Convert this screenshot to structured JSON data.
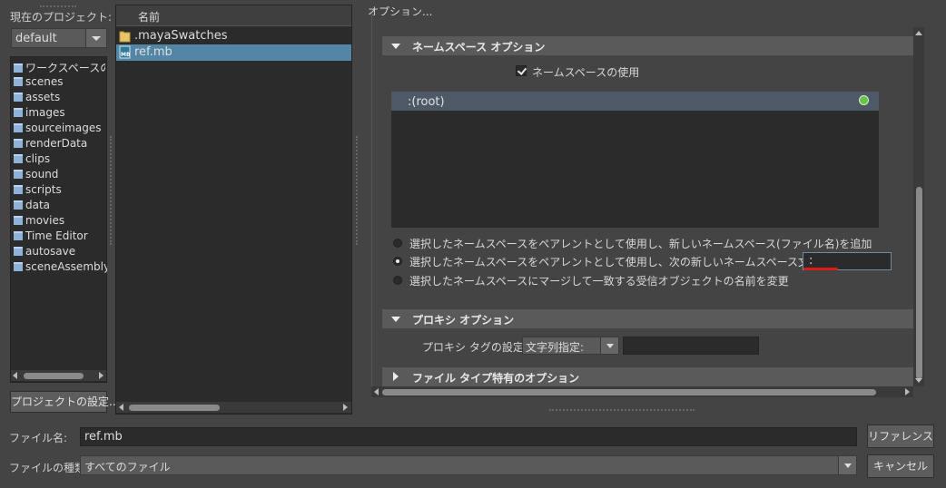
{
  "project": {
    "label": "現在のプロジェクト:",
    "selected": "default",
    "settings_button": "プロジェクトの設定..."
  },
  "tree": [
    "ワークスペースのルート",
    "scenes",
    "assets",
    "images",
    "sourceimages",
    "renderData",
    "clips",
    "sound",
    "scripts",
    "data",
    "movies",
    "Time Editor",
    "autosave",
    "sceneAssembly"
  ],
  "files": {
    "header": "名前",
    "items": [
      {
        "name": ".mayaSwatches",
        "icon": "folder-icon",
        "selected": false
      },
      {
        "name": "ref.mb",
        "icon": "maya-binary-file-icon",
        "selected": true
      }
    ],
    "mb_badge": "MB"
  },
  "options": {
    "title": "オプション...",
    "namespace": {
      "header": "ネームスペース オプション",
      "use_namespace": "ネームスペースの使用",
      "root": ":(root)",
      "radio1": "選択したネームスペースをペアレントとして使用し、新しいネームスペース(ファイル名)を追加",
      "radio2": "選択したネームスペースをペアレントとして使用し、次の新しいネームスペース文字列を追加:",
      "radio2_value": ":",
      "radio3": "選択したネームスペースにマージして一致する受信オブジェクトの名前を変更"
    },
    "proxy": {
      "header": "プロキシ オプション",
      "tag_label": "プロキシ タグの設定:",
      "tag_mode": "文字列指定:"
    },
    "filetype": {
      "header": "ファイル タイプ特有のオプション"
    }
  },
  "bottom": {
    "filename_label": "ファイル名:",
    "filename_value": "ref.mb",
    "filetype_label": "ファイルの種類:",
    "filetype_value": "すべてのファイル",
    "reference_button": "リファレンス",
    "cancel_button": "キャンセル"
  },
  "colors": {
    "selection": "#5285a6",
    "root_indicator": "#6bc24a",
    "annotation_underline": "#e01919"
  }
}
